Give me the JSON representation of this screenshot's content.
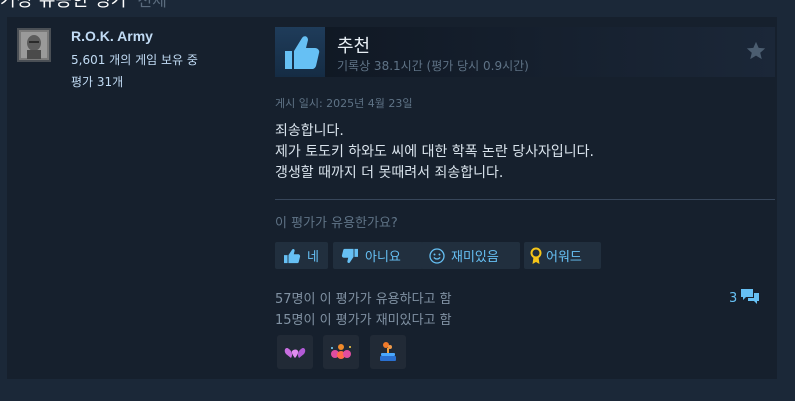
{
  "section": {
    "title": "가장 유용한 평가",
    "all_link": "전체"
  },
  "author": {
    "name": "R.O.K. Army",
    "games_owned": "5,601 개의 게임 보유 중",
    "reviews_count": "평가 31개"
  },
  "review": {
    "verdict": "추천",
    "hours": "기록상 38.1시간 (평가 당시 0.9시간)",
    "posted": "게시 일시: 2025년 4월 23일",
    "text_lines": [
      "죄송합니다.",
      "제가 토도키 하와도 씨에 대한 학폭 논란 당사자입니다.",
      "갱생할 때까지 더 못때려서 죄송합니다."
    ],
    "helpful_question": "이 평가가 유용한가요?"
  },
  "buttons": {
    "yes": "네",
    "no": "아니요",
    "funny": "재미있음",
    "award": "어워드"
  },
  "stats": {
    "helpful": "57명이 이 평가가 유용하다고 함",
    "funny": "15명이 이 평가가 재미있다고 함",
    "comment_count": "3"
  },
  "awards": [
    "heart-award-icon",
    "party-award-icon",
    "cake-award-icon"
  ],
  "colors": {
    "background": "#1b2838",
    "card": "#16202d",
    "accent": "#66c0f4",
    "author_name": "#c1dbf4"
  }
}
